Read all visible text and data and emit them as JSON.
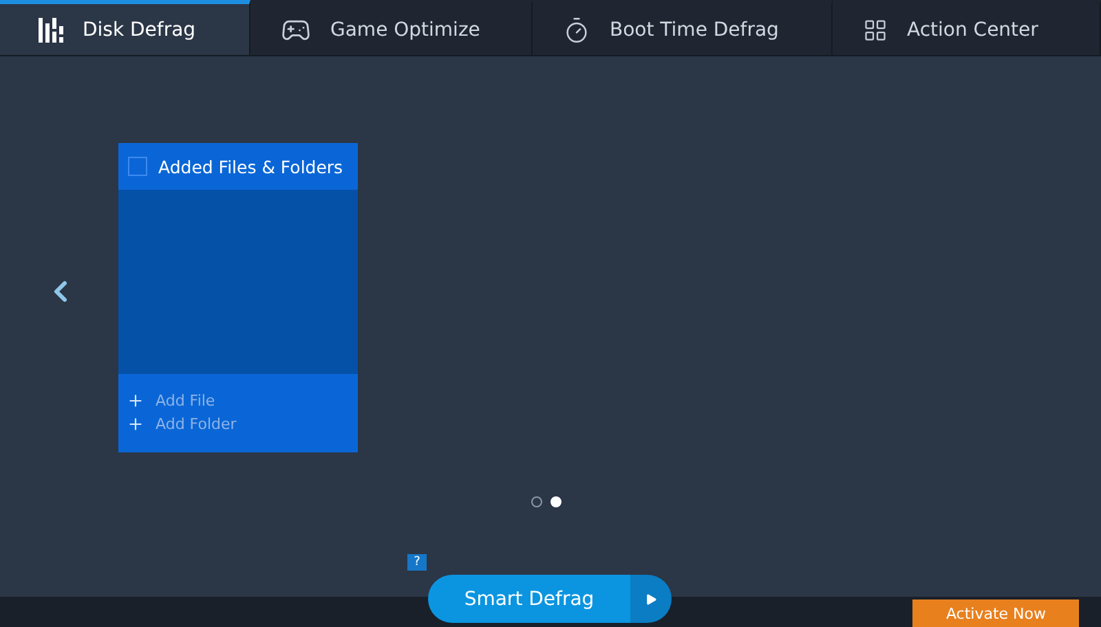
{
  "tabs": [
    {
      "label": "Disk Defrag",
      "selected": true
    },
    {
      "label": "Game Optimize",
      "selected": false
    },
    {
      "label": "Boot Time Defrag",
      "selected": false
    },
    {
      "label": "Action Center",
      "selected": false
    }
  ],
  "card": {
    "title": "Added Files & Folders",
    "checked": false,
    "actions": [
      "Add File",
      "Add Folder"
    ]
  },
  "pages": [
    {
      "selected": false
    },
    {
      "selected": true
    }
  ],
  "help_badge": "?",
  "primary_button": "Smart Defrag",
  "activate_button": "Activate Now"
}
